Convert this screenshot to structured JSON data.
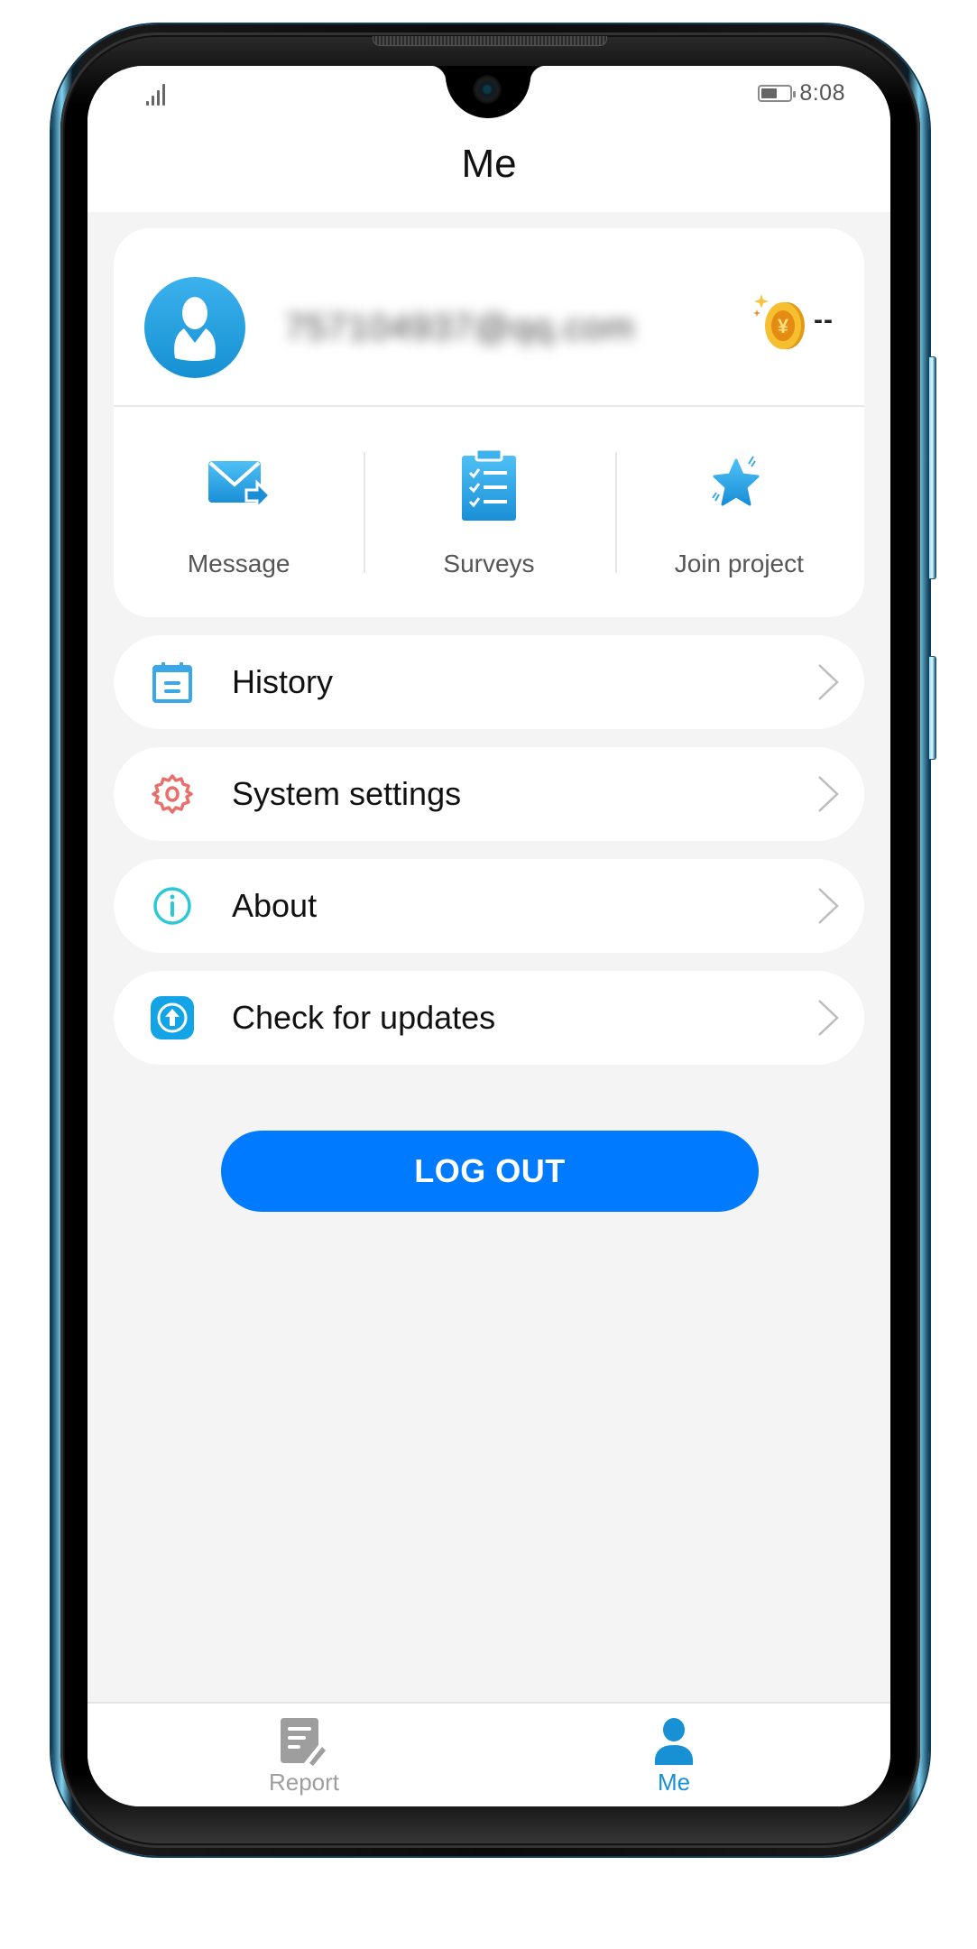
{
  "status_bar": {
    "signal_icon": "signal-bars-icon",
    "battery_icon": "battery-icon",
    "battery_level": 0.55,
    "time": "8:08"
  },
  "header": {
    "title": "Me"
  },
  "profile": {
    "avatar_icon": "user-avatar-icon",
    "email": "757104937@qq.com",
    "email_blurred": true,
    "coin_icon": "gold-coin-yuan-icon",
    "coin_value": "--"
  },
  "quick_actions": [
    {
      "label": "Message",
      "icon": "mail-forward-icon"
    },
    {
      "label": "Surveys",
      "icon": "clipboard-checklist-icon"
    },
    {
      "label": "Join project",
      "icon": "star-icon"
    }
  ],
  "menu": [
    {
      "label": "History",
      "icon": "calendar-list-icon",
      "icon_color": "#3aa7e8"
    },
    {
      "label": "System settings",
      "icon": "gear-icon",
      "icon_color": "#e8706a"
    },
    {
      "label": "About",
      "icon": "info-circle-icon",
      "icon_color": "#2bc9d6"
    },
    {
      "label": "Check for updates",
      "icon": "upload-arrow-icon",
      "icon_color": "#12a4e6"
    }
  ],
  "logout": {
    "label": "LOG OUT",
    "color": "#007bff"
  },
  "bottom_nav": {
    "tabs": [
      {
        "label": "Report",
        "icon": "report-edit-icon",
        "active": false
      },
      {
        "label": "Me",
        "icon": "person-icon",
        "active": true
      }
    ],
    "active_color": "#1890d4",
    "inactive_color": "#9e9e9e"
  }
}
